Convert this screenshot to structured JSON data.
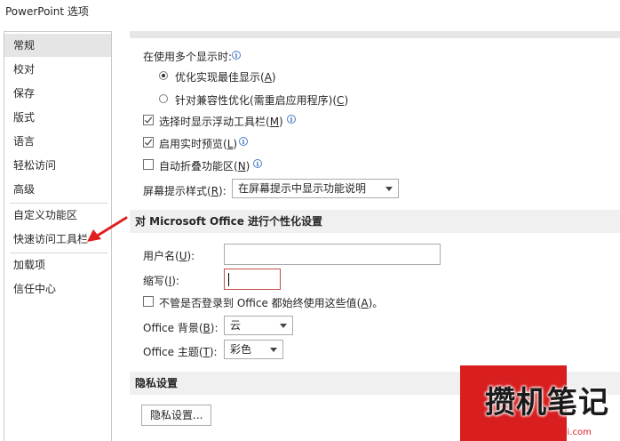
{
  "window": {
    "title": "PowerPoint 选项"
  },
  "sidebar": {
    "items": [
      {
        "label": "常规",
        "active": true
      },
      {
        "label": "校对"
      },
      {
        "label": "保存"
      },
      {
        "label": "版式"
      },
      {
        "label": "语言"
      },
      {
        "label": "轻松访问"
      },
      {
        "label": "高级"
      },
      {
        "label": "自定义功能区"
      },
      {
        "label": "快速访问工具栏"
      },
      {
        "label": "加载项"
      },
      {
        "label": "信任中心"
      }
    ]
  },
  "ui_options": {
    "multi_display_label_pre": "在使用多个显示时:",
    "radio_optimize": {
      "pre": "优化实现最佳显示(",
      "key": "A",
      "post": ")",
      "selected": true
    },
    "radio_compat": {
      "pre": "针对兼容性优化(需重启应用程序)(",
      "key": "C",
      "post": ")",
      "selected": false
    },
    "mini_toolbar": {
      "pre": "选择时显示浮动工具栏(",
      "key": "M",
      "post": ")",
      "checked": true
    },
    "live_preview": {
      "pre": "启用实时预览(",
      "key": "L",
      "post": ")",
      "checked": true
    },
    "collapse_ribbon": {
      "pre": "自动折叠功能区(",
      "key": "N",
      "post": ")",
      "checked": false
    },
    "screentip": {
      "pre": "屏幕提示样式(",
      "key": "R",
      "post": "):",
      "value": "在屏幕提示中显示功能说明"
    }
  },
  "personalize": {
    "heading": "对 Microsoft Office 进行个性化设置",
    "username": {
      "pre": "用户名(",
      "key": "U",
      "post": "):",
      "value": ""
    },
    "initials": {
      "pre": "缩写(",
      "key": "I",
      "post": "):",
      "value": ""
    },
    "always_use": {
      "pre": "不管是否登录到 Office 都始终使用这些值(",
      "key": "A",
      "post": ")。",
      "checked": false
    },
    "background": {
      "pre": "Office 背景(",
      "key": "B",
      "post": "):",
      "value": "云"
    },
    "theme": {
      "pre": "Office 主题(",
      "key": "T",
      "post": "):",
      "value": "彩色"
    }
  },
  "privacy": {
    "heading": "隐私设置",
    "button_label": "隐私设置..."
  },
  "watermark": {
    "text": "攒机笔记",
    "url": "www.cuanjibiji.com"
  },
  "colors": {
    "accent_arrow": "#e02020",
    "watermark_red": "#d81e1e",
    "active_nav": "#e5e5e5"
  }
}
